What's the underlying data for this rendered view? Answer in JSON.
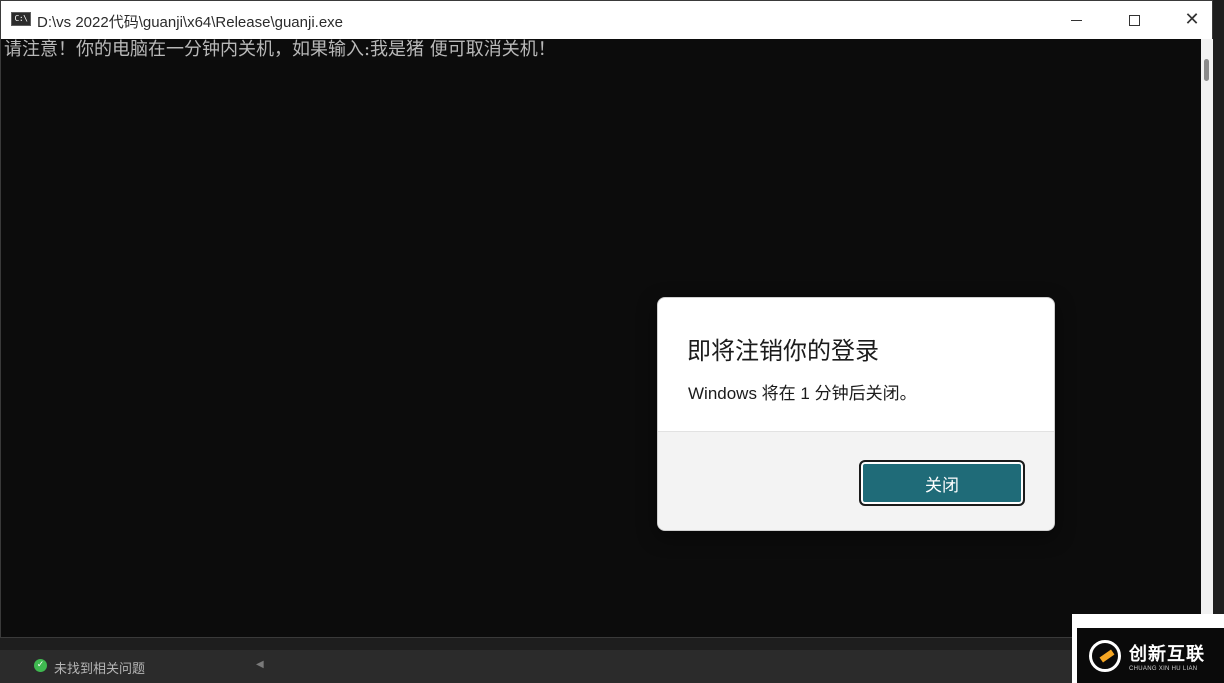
{
  "window": {
    "title": "D:\\vs 2022代码\\guanji\\x64\\Release\\guanji.exe",
    "icon": "console-app-icon",
    "icon_label": "C:\\",
    "close_glyph": "✕"
  },
  "console": {
    "output": "请注意！你的电脑在一分钟内关机，如果输入:我是猪 便可取消关机！"
  },
  "dialog": {
    "title": "即将注销你的登录",
    "message": "Windows 将在 1 分钟后关闭。",
    "close_label": "关闭",
    "accent_color": "#1f6b78"
  },
  "statusbar": {
    "text": "未找到相关问题",
    "check_glyph": "✓",
    "arrow_glyph": "◀",
    "status_color": "#3fb950"
  },
  "watermark": {
    "main": "创新互联",
    "sub": "CHUANG XIN HU LIAN"
  }
}
